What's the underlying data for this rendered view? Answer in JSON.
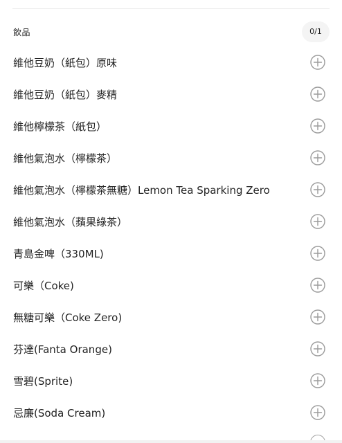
{
  "section": {
    "title": "飲品",
    "count": "0/1"
  },
  "items": [
    {
      "name": "維他豆奶（紙包）原味"
    },
    {
      "name": "維他豆奶（紙包）麥精"
    },
    {
      "name": "維他檸檬茶（紙包）"
    },
    {
      "name": "維他氣泡水（檸檬茶）"
    },
    {
      "name": "維他氣泡水（檸檬茶無糖）Lemon Tea Sparking Zero"
    },
    {
      "name": "維他氣泡水（蘋果綠茶）"
    },
    {
      "name": "青島金啤（330ML)"
    },
    {
      "name": "可樂（Coke)"
    },
    {
      "name": "無糖可樂（Coke Zero)"
    },
    {
      "name": "芬達(Fanta Orange)"
    },
    {
      "name": "雪碧(Sprite)"
    },
    {
      "name": "忌廉(Soda Cream)"
    }
  ],
  "icons": {
    "add": "plus-circle-icon"
  },
  "colors": {
    "icon_stroke": "#9b9b9b",
    "badge_bg": "#f4f4f4",
    "text": "#222222"
  }
}
